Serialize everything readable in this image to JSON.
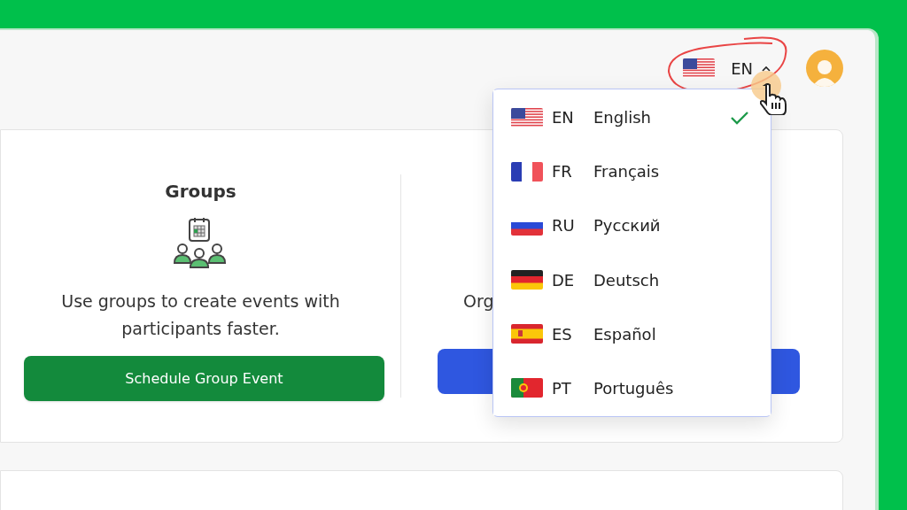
{
  "header": {
    "language_button": {
      "code": "EN",
      "expanded": true,
      "kind": "us"
    }
  },
  "groups_card": {
    "title": "Groups",
    "description": "Use groups to create events with participants faster.",
    "button": "Schedule Group Event"
  },
  "second_card": {
    "description": "Org"
  },
  "language_menu": [
    {
      "kind": "us",
      "code": "EN",
      "name": "English",
      "selected": true
    },
    {
      "kind": "fr",
      "code": "FR",
      "name": "Français",
      "selected": false
    },
    {
      "kind": "ru",
      "code": "RU",
      "name": "Русский",
      "selected": false
    },
    {
      "kind": "de",
      "code": "DE",
      "name": "Deutsch",
      "selected": false
    },
    {
      "kind": "es",
      "code": "ES",
      "name": "Español",
      "selected": false
    },
    {
      "kind": "pt",
      "code": "PT",
      "name": "Português",
      "selected": false
    }
  ]
}
